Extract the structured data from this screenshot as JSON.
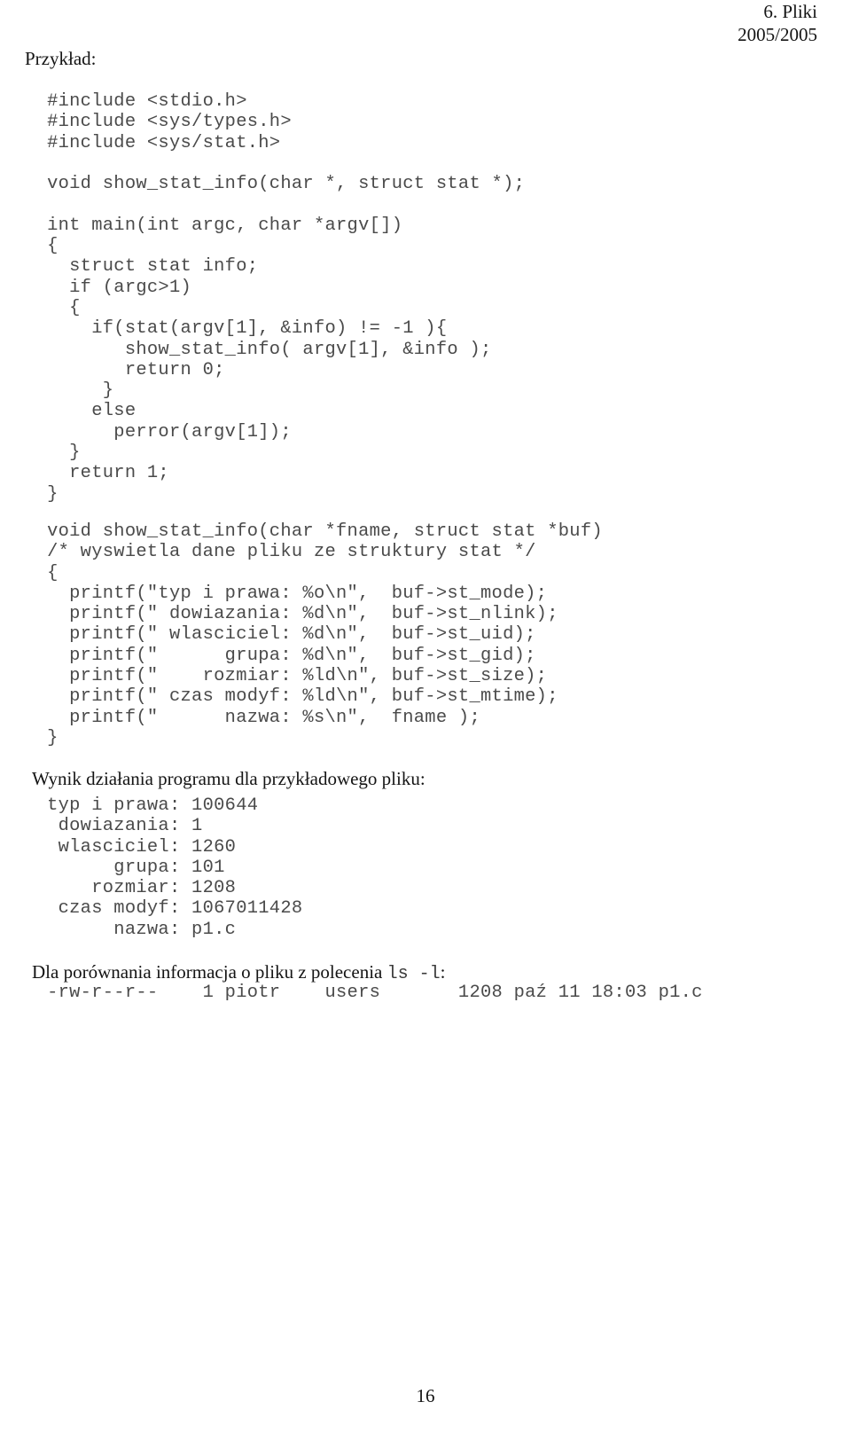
{
  "header": {
    "chapter": "6. Pliki",
    "year": "2005/2005"
  },
  "labels": {
    "example": "Przykład:",
    "program_result": "Wynik działania programu dla przykładowego pliku:",
    "comparison_prefix": "Dla porównania informacja o pliku z polecenia ",
    "comparison_command": "ls -l",
    "comparison_suffix": ":"
  },
  "code_main": [
    "  #include <stdio.h>",
    "  #include <sys/types.h>",
    "  #include <sys/stat.h>",
    "",
    "  void show_stat_info(char *, struct stat *);",
    "",
    "  int main(int argc, char *argv[])",
    "  {",
    "    struct stat info;",
    "    if (argc>1)",
    "    {",
    "      if(stat(argv[1], &info) != -1 ){",
    "         show_stat_info( argv[1], &info );",
    "         return 0;",
    "       }",
    "      else",
    "        perror(argv[1]);",
    "    }",
    "    return 1;",
    "  }"
  ],
  "code_func": [
    "  void show_stat_info(char *fname, struct stat *buf)",
    "  /* wyswietla dane pliku ze struktury stat */",
    "  {",
    "    printf(\"typ i prawa: %o\\n\",  buf->st_mode);",
    "    printf(\" dowiazania: %d\\n\",  buf->st_nlink);",
    "    printf(\" wlasciciel: %d\\n\",  buf->st_uid);",
    "    printf(\"      grupa: %d\\n\",  buf->st_gid);",
    "    printf(\"    rozmiar: %ld\\n\", buf->st_size);",
    "    printf(\" czas modyf: %ld\\n\", buf->st_mtime);",
    "    printf(\"      nazwa: %s\\n\",  fname );",
    "  }"
  ],
  "code_output": [
    "  typ i prawa: 100644",
    "   dowiazania: 1",
    "   wlasciciel: 1260",
    "        grupa: 101",
    "      rozmiar: 1208",
    "   czas modyf: 1067011428",
    "        nazwa: p1.c"
  ],
  "code_ls": [
    "  -rw-r--r--    1 piotr    users       1208 paź 11 18:03 p1.c"
  ],
  "footer": {
    "page_number": "16"
  }
}
